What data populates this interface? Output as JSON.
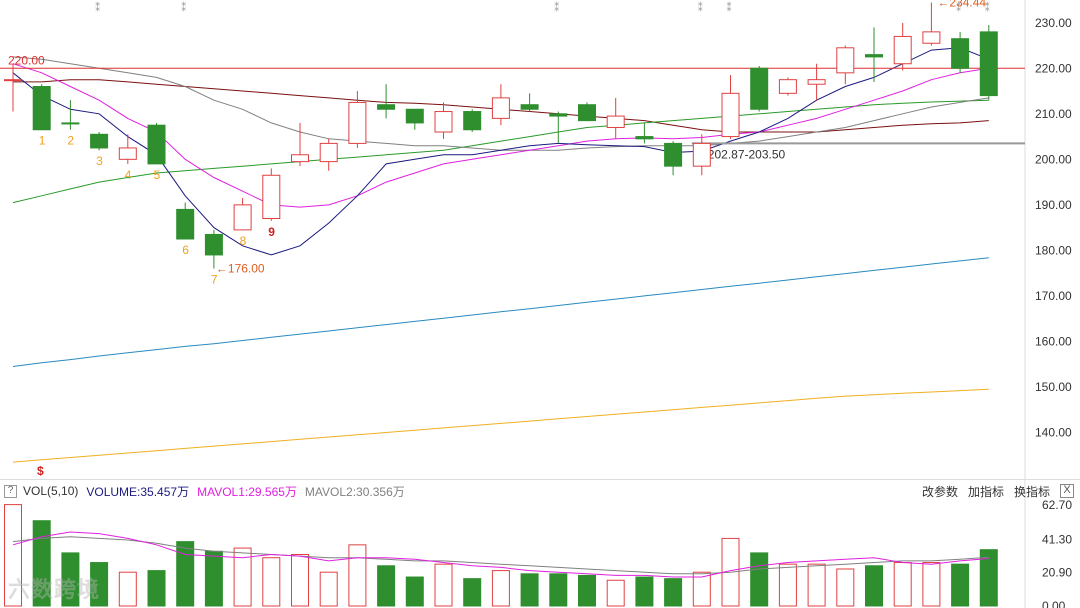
{
  "chart_data": {
    "type": "candlestick",
    "price_axis": {
      "min": 130,
      "max": 235,
      "ticks": [
        230,
        220,
        210,
        200,
        190,
        180,
        170,
        160,
        150,
        140
      ]
    },
    "price_tick_labels": [
      "230.00",
      "220.00",
      "210.00",
      "200.00",
      "190.00",
      "180.00",
      "170.00",
      "160.00",
      "150.00",
      "140.00"
    ],
    "candles": [
      {
        "o": 217.5,
        "h": 221.0,
        "l": 210.5,
        "c": 217.5,
        "up": true
      },
      {
        "o": 216.0,
        "h": 216.5,
        "l": 206.5,
        "c": 206.5,
        "up": false
      },
      {
        "o": 208.0,
        "h": 213.0,
        "l": 206.5,
        "c": 208.0,
        "up": false
      },
      {
        "o": 205.5,
        "h": 206.0,
        "l": 202.0,
        "c": 202.5,
        "up": false
      },
      {
        "o": 200.0,
        "h": 205.5,
        "l": 199.0,
        "c": 202.5,
        "up": true
      },
      {
        "o": 207.5,
        "h": 208.0,
        "l": 199.0,
        "c": 199.0,
        "up": false
      },
      {
        "o": 189.0,
        "h": 190.5,
        "l": 182.5,
        "c": 182.5,
        "up": false
      },
      {
        "o": 183.5,
        "h": 184.5,
        "l": 176.0,
        "c": 179.0,
        "up": false
      },
      {
        "o": 184.5,
        "h": 191.5,
        "l": 184.5,
        "c": 190.0,
        "up": true
      },
      {
        "o": 187.0,
        "h": 198.0,
        "l": 186.5,
        "c": 196.5,
        "up": true
      },
      {
        "o": 199.5,
        "h": 208.0,
        "l": 198.5,
        "c": 201.0,
        "up": true
      },
      {
        "o": 199.5,
        "h": 204.5,
        "l": 197.5,
        "c": 203.5,
        "up": true
      },
      {
        "o": 203.5,
        "h": 215.0,
        "l": 202.5,
        "c": 212.5,
        "up": true
      },
      {
        "o": 212.0,
        "h": 216.5,
        "l": 209.0,
        "c": 211.0,
        "up": false
      },
      {
        "o": 211.0,
        "h": 211.0,
        "l": 206.5,
        "c": 208.0,
        "up": false
      },
      {
        "o": 206.0,
        "h": 212.5,
        "l": 204.5,
        "c": 210.5,
        "up": true
      },
      {
        "o": 210.5,
        "h": 211.0,
        "l": 206.0,
        "c": 206.5,
        "up": false
      },
      {
        "o": 209.0,
        "h": 216.5,
        "l": 207.5,
        "c": 213.5,
        "up": true
      },
      {
        "o": 212.0,
        "h": 214.5,
        "l": 210.5,
        "c": 211.0,
        "up": false
      },
      {
        "o": 210.0,
        "h": 210.5,
        "l": 203.5,
        "c": 209.5,
        "up": false
      },
      {
        "o": 212.0,
        "h": 212.5,
        "l": 208.5,
        "c": 208.5,
        "up": false
      },
      {
        "o": 207.0,
        "h": 213.5,
        "l": 204.5,
        "c": 209.5,
        "up": true
      },
      {
        "o": 205.0,
        "h": 208.0,
        "l": 203.5,
        "c": 204.5,
        "up": false
      },
      {
        "o": 203.5,
        "h": 204.0,
        "l": 196.5,
        "c": 198.5,
        "up": false
      },
      {
        "o": 198.5,
        "h": 205.5,
        "l": 196.5,
        "c": 203.5,
        "up": true
      },
      {
        "o": 205.0,
        "h": 218.5,
        "l": 204.5,
        "c": 214.5,
        "up": true
      },
      {
        "o": 220.0,
        "h": 220.5,
        "l": 210.5,
        "c": 211.0,
        "up": false
      },
      {
        "o": 214.5,
        "h": 218.0,
        "l": 214.0,
        "c": 217.5,
        "up": true
      },
      {
        "o": 216.5,
        "h": 221.0,
        "l": 213.0,
        "c": 217.5,
        "up": true
      },
      {
        "o": 219.0,
        "h": 225.0,
        "l": 216.5,
        "c": 224.5,
        "up": true
      },
      {
        "o": 223.0,
        "h": 229.0,
        "l": 217.0,
        "c": 222.5,
        "up": false
      },
      {
        "o": 221.0,
        "h": 230.0,
        "l": 219.5,
        "c": 227.0,
        "up": true
      },
      {
        "o": 225.5,
        "h": 234.44,
        "l": 225.0,
        "c": 228.0,
        "up": true
      },
      {
        "o": 226.5,
        "h": 228.0,
        "l": 219.0,
        "c": 220.0,
        "up": false
      },
      {
        "o": 228.0,
        "h": 229.5,
        "l": 213.0,
        "c": 214.0,
        "up": false
      }
    ],
    "candle_labels": [
      {
        "idx": 1,
        "text": "1",
        "color": "#f0a020"
      },
      {
        "idx": 2,
        "text": "2",
        "color": "#f0a020"
      },
      {
        "idx": 3,
        "text": "3",
        "color": "#f0a020"
      },
      {
        "idx": 4,
        "text": "4",
        "color": "#f0a020"
      },
      {
        "idx": 5,
        "text": "5",
        "color": "#f0a020"
      },
      {
        "idx": 6,
        "text": "6",
        "color": "#f0a020"
      },
      {
        "idx": 7,
        "text": "7",
        "color": "#f0a020"
      },
      {
        "idx": 8,
        "text": "8",
        "color": "#f0a020"
      },
      {
        "idx": 9,
        "text": "9",
        "color": "#d02020"
      }
    ],
    "ma_series": [
      {
        "color": "#1a1a80",
        "values": [
          219,
          214,
          211,
          210,
          205,
          201,
          192,
          185,
          181,
          179,
          181,
          186,
          192,
          199,
          200,
          201,
          201,
          202,
          203,
          203.5,
          203.2,
          203,
          202.8,
          201.5,
          201.8,
          204,
          206,
          209,
          213,
          216,
          218,
          221,
          224,
          224.5,
          222
        ]
      },
      {
        "color": "#e020e0",
        "values": [
          221,
          219,
          216,
          213,
          209,
          206,
          200,
          196,
          193,
          190,
          189.5,
          190,
          192,
          195,
          197,
          199,
          200,
          201,
          202,
          203,
          204,
          204.5,
          204.7,
          204.5,
          204.8,
          205.5,
          206,
          207.5,
          209,
          211,
          213,
          215,
          217.5,
          219,
          220
        ]
      },
      {
        "color": "#808080",
        "values": [
          222.5,
          222,
          221,
          220,
          219,
          218,
          216,
          213,
          211,
          208,
          206,
          204.5,
          204,
          203.5,
          203,
          203,
          202.5,
          202,
          202,
          202,
          202.5,
          202.8,
          203,
          203,
          203,
          203.5,
          204,
          205,
          206,
          207,
          208.5,
          210,
          211.5,
          212.5,
          213.5
        ]
      },
      {
        "color": "#7a1010",
        "values": [
          217,
          217,
          217.5,
          217.5,
          217,
          216.5,
          216,
          215.5,
          215,
          214.5,
          214,
          213.5,
          213,
          212.5,
          212.3,
          212,
          211.5,
          211,
          210.5,
          210,
          209.5,
          209,
          208.5,
          207.5,
          206.5,
          206,
          206,
          206,
          206,
          206.5,
          207,
          207.5,
          207.8,
          208,
          208.5
        ]
      },
      {
        "color": "#2a9a2a",
        "values": [
          190.5,
          192,
          193.5,
          195,
          196,
          197,
          197.5,
          198,
          198.5,
          199,
          199.5,
          200,
          200.5,
          201,
          201.5,
          202,
          203,
          204,
          205,
          206,
          207,
          207.5,
          208,
          208.5,
          209,
          209.5,
          210,
          210.5,
          211,
          211.5,
          212,
          212.3,
          212.6,
          212.8,
          213
        ]
      },
      {
        "color": "#2a8ac0",
        "values": [
          154.5,
          155.3,
          156,
          156.8,
          157.5,
          158.2,
          158.9,
          159.5,
          160.2,
          160.9,
          161.6,
          162.3,
          163,
          163.7,
          164.4,
          165.1,
          165.8,
          166.5,
          167.2,
          167.9,
          168.6,
          169.3,
          170,
          170.7,
          171.4,
          172.1,
          172.8,
          173.5,
          174.2,
          174.9,
          175.6,
          176.3,
          177,
          177.7,
          178.4
        ]
      },
      {
        "color": "#f0b020",
        "values": [
          133.5,
          134,
          134.5,
          135,
          135.5,
          136,
          136.5,
          137,
          137.5,
          138,
          138.5,
          139,
          139.5,
          140,
          140.5,
          141,
          141.5,
          142,
          142.5,
          143,
          143.5,
          144,
          144.5,
          145,
          145.5,
          146,
          146.5,
          147,
          147.5,
          148,
          148.3,
          148.6,
          148.9,
          149.2,
          149.5
        ]
      }
    ],
    "resistance_line": {
      "value": 220.0,
      "label": "220.00",
      "color": "#e03030"
    },
    "support_zone": {
      "value": 203.5,
      "label": "202.87-203.50",
      "color": "#999999"
    },
    "annotations": [
      {
        "text": "234.44",
        "color": "#e06020"
      },
      {
        "text": "176.00",
        "color": "#e06020"
      }
    ],
    "signal_markers": [
      "$"
    ],
    "volume": {
      "title": "VOL(5,10)",
      "volume_label": "VOLUME:35.457万",
      "mavol1_label": "MAVOL1:29.565万",
      "mavol2_label": "MAVOL2:30.356万",
      "axis_ticks": [
        62.7,
        41.3,
        20.9,
        0.0
      ],
      "axis_tick_labels": [
        "62.70",
        "41.30",
        "20.90",
        "0.00"
      ],
      "axis_max": 64,
      "bars": [
        63,
        53,
        33,
        27,
        21,
        22,
        40,
        34,
        36,
        30,
        32,
        21,
        38,
        25,
        18,
        26,
        17,
        22,
        20,
        20,
        19,
        16,
        18,
        17,
        21,
        42,
        33,
        26,
        26,
        23,
        25,
        27,
        27,
        26,
        35
      ],
      "mavol1": [
        38,
        43,
        46,
        45,
        42,
        38,
        32,
        31,
        30,
        32,
        31,
        28,
        30,
        30,
        29,
        27,
        25,
        24,
        22,
        21,
        20,
        19,
        19,
        18,
        18,
        22,
        25,
        27,
        28,
        29,
        30,
        27,
        26,
        28,
        29.5
      ],
      "mavol2": [
        40,
        42,
        43,
        42,
        41,
        39,
        36,
        34,
        33,
        32,
        31,
        30,
        30,
        29,
        28,
        28,
        27,
        26,
        25,
        24,
        23,
        22,
        21,
        20,
        20,
        21,
        23,
        24,
        25,
        26,
        27,
        28,
        28,
        29,
        30.3
      ]
    }
  },
  "toolbar": {
    "box_label": "?",
    "vol_title": "VOL(5,10)",
    "volume_label": "VOLUME:35.457万",
    "mavol1_label": "MAVOL1:29.565万",
    "mavol2_label": "MAVOL2:30.356万",
    "change_params": "改参数",
    "add_indicator": "加指标",
    "switch_indicator": "换指标",
    "close_label": "X"
  },
  "colors": {
    "up": "#e04040",
    "down": "#2f8f2f",
    "volume_label": "#1a1a80",
    "mavol1": "#e020e0",
    "mavol2": "#808080",
    "grid": "#e6e6e6"
  },
  "watermark": "六数跨境"
}
